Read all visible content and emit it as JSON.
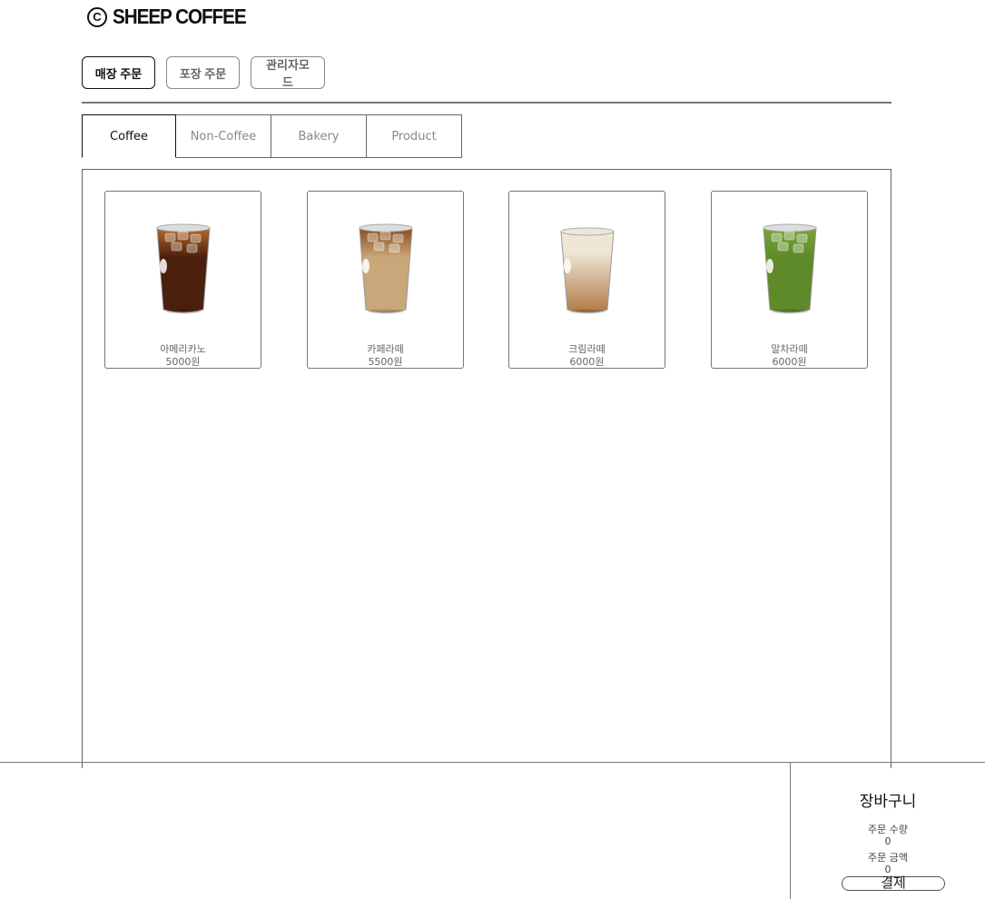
{
  "brand": {
    "mark": "C",
    "name": "SHEEP COFFEE"
  },
  "modes": [
    {
      "label": "매장 주문",
      "active": true
    },
    {
      "label": "포장 주문",
      "active": false
    },
    {
      "label": "관리자모드",
      "active": false
    }
  ],
  "tabs": [
    {
      "label": "Coffee",
      "active": true
    },
    {
      "label": "Non-Coffee",
      "active": false
    },
    {
      "label": "Bakery",
      "active": false
    },
    {
      "label": "Product",
      "active": false
    }
  ],
  "products": [
    {
      "name": "아메리카노",
      "price": "5000원",
      "drink_color": "#4a1f0c",
      "foam_color": "#b56a2c",
      "image_icon": "iced-americano-icon"
    },
    {
      "name": "카페라떼",
      "price": "5500원",
      "drink_color": "#c9a77a",
      "foam_color": "#8a4a1c",
      "image_icon": "iced-latte-icon"
    },
    {
      "name": "크림라떼",
      "price": "6000원",
      "drink_color": "#b07a45",
      "foam_color": "#efe6d6",
      "image_icon": "cream-latte-icon"
    },
    {
      "name": "말차라떼",
      "price": "6000원",
      "drink_color": "#5e8a2a",
      "foam_color": "#7aa33a",
      "image_icon": "matcha-latte-icon"
    }
  ],
  "cart": {
    "title": "장바구니",
    "qty_label": "주문 수량",
    "qty_value": "0",
    "amount_label": "주문 금액",
    "amount_value": "0",
    "pay_label": "결제"
  }
}
